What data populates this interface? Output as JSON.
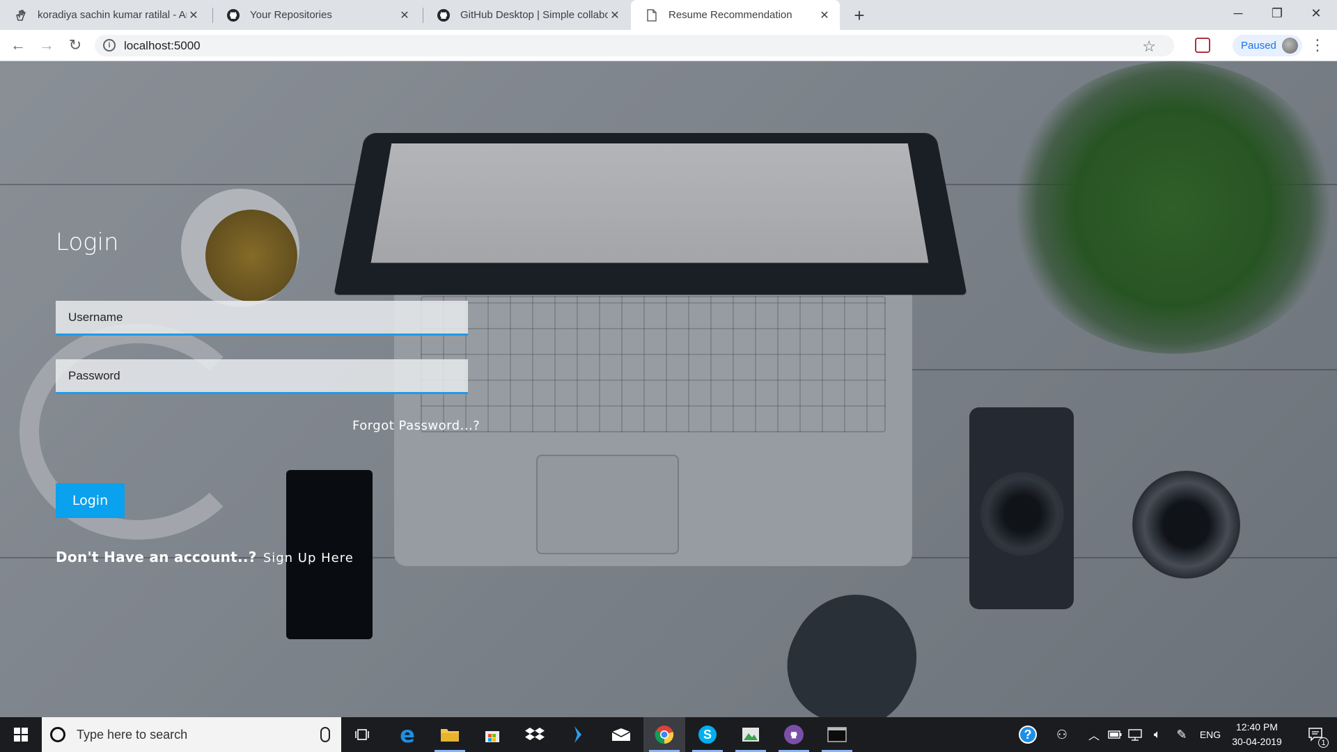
{
  "browser": {
    "tabs": [
      {
        "title": "koradiya sachin kumar ratilal - Ar",
        "icon": "hand-emoji-icon",
        "active": false
      },
      {
        "title": "Your Repositories",
        "icon": "github-icon",
        "active": false
      },
      {
        "title": "GitHub Desktop | Simple collabor",
        "icon": "github-icon",
        "active": false
      },
      {
        "title": "Resume Recommendation",
        "icon": "page-icon",
        "active": true
      }
    ],
    "new_tab_label": "+",
    "url": "localhost:5000",
    "profile_status": "Paused"
  },
  "login": {
    "title": "Login",
    "username_placeholder": "Username",
    "password_placeholder": "Password",
    "forgot_label": "Forgot Password...?",
    "button_label": "Login",
    "no_account_text": "Don't Have an account..?",
    "signup_label": "Sign Up Here"
  },
  "taskbar": {
    "search_placeholder": "Type here to search",
    "tray_language": "ENG",
    "time": "12:40 PM",
    "date": "30-04-2019",
    "notification_count": "1"
  },
  "colors": {
    "accent": "#0aa1ee",
    "input_underline": "#1e9be8",
    "taskbar": "#1b1c1f"
  }
}
